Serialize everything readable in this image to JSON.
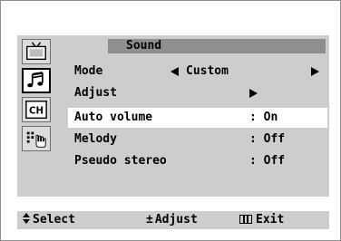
{
  "menu": {
    "title": "Sound",
    "rows": [
      {
        "label": "Mode",
        "value": "Custom"
      },
      {
        "label": "Adjust"
      },
      {
        "label": "Auto volume",
        "value": ": On"
      },
      {
        "label": "Melody",
        "value": ": Off"
      },
      {
        "label": "Pseudo stereo",
        "value": ": Off"
      }
    ],
    "highlighted_row": "Auto volume"
  },
  "sidebar": {
    "items": [
      {
        "icon": "tv-picture-icon",
        "selected": false
      },
      {
        "icon": "music-note-icon",
        "selected": true
      },
      {
        "icon": "channel-icon",
        "label": "CH",
        "selected": false
      },
      {
        "icon": "setup-hand-icon",
        "selected": false
      }
    ]
  },
  "footer": {
    "select_label": "Select",
    "adjust_label": "Adjust",
    "adjust_glyph": "±",
    "exit_label": "Exit"
  },
  "colors": {
    "panel": "#cdcdcd",
    "title_bar": "#8f8f8f",
    "highlight": "#ffffff",
    "text": "#000000"
  }
}
